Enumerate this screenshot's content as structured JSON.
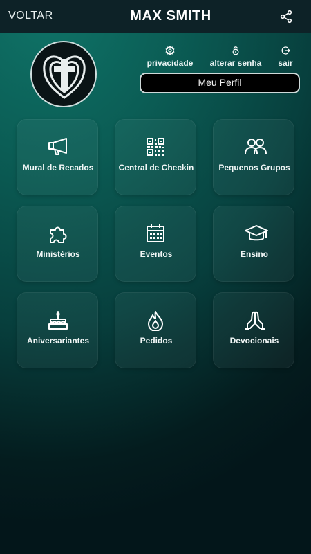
{
  "header": {
    "back_label": "VOLTAR",
    "title": "MAX SMITH",
    "share_icon": "share-icon"
  },
  "actions": [
    {
      "label": "privacidade",
      "icon": "gear-icon"
    },
    {
      "label": "alterar senha",
      "icon": "lock-icon"
    },
    {
      "label": "sair",
      "icon": "logout-icon"
    }
  ],
  "profile_button": {
    "label": "Meu Perfil"
  },
  "menu": [
    {
      "label": "Mural de Recados",
      "icon": "megaphone-icon"
    },
    {
      "label": "Central de Checkin",
      "icon": "qr-code-icon"
    },
    {
      "label": "Pequenos Grupos",
      "icon": "group-icon"
    },
    {
      "label": "Ministérios",
      "icon": "puzzle-icon"
    },
    {
      "label": "Eventos",
      "icon": "calendar-icon"
    },
    {
      "label": "Ensino",
      "icon": "graduation-cap-icon"
    },
    {
      "label": "Aniversariantes",
      "icon": "birthday-cake-icon"
    },
    {
      "label": "Pedidos",
      "icon": "flame-icon"
    },
    {
      "label": "Devocionais",
      "icon": "praying-hands-icon"
    }
  ],
  "colors": {
    "topbar": "#0d2227",
    "bg_top": "#0f7468",
    "bg_bottom": "#03161a",
    "button_bg": "#000000"
  }
}
